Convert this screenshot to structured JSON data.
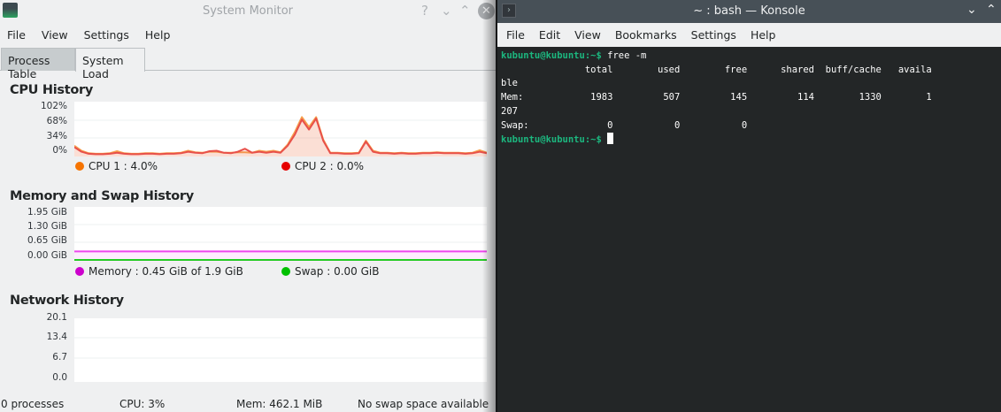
{
  "sysmon": {
    "title": "System Monitor",
    "menu": [
      "File",
      "View",
      "Settings",
      "Help"
    ],
    "tabs": [
      "Process Table",
      "System Load"
    ],
    "cpu": {
      "title": "CPU History",
      "yticks": [
        "102%",
        "68%",
        "34%",
        "0%"
      ],
      "legend": [
        {
          "label": "CPU 1 : 4.0%",
          "color": "#f67400"
        },
        {
          "label": "CPU 2 : 0.0%",
          "color": "#e60000"
        }
      ]
    },
    "memory": {
      "title": "Memory and Swap History",
      "yticks": [
        "1.95 GiB",
        "1.30 GiB",
        "0.65 GiB",
        "0.00 GiB"
      ],
      "legend": [
        {
          "label": "Memory : 0.45 GiB of 1.9 GiB",
          "color": "#cc00cc"
        },
        {
          "label": "Swap : 0.00 GiB",
          "color": "#00c000"
        }
      ]
    },
    "network": {
      "title": "Network History",
      "yticks": [
        "20.1",
        "13.4",
        "6.7",
        "0.0"
      ]
    },
    "status": {
      "processes": "0 processes",
      "cpu": "CPU: 3%",
      "mem": "Mem: 462.1 MiB",
      "swap": "No swap space available"
    }
  },
  "chart_data": [
    {
      "type": "area",
      "title": "CPU History",
      "ylim": [
        0,
        102
      ],
      "series": [
        {
          "name": "CPU 1",
          "color": "#f6a04d",
          "values": [
            18,
            8,
            3,
            2,
            2,
            3,
            7,
            3,
            2,
            2,
            3,
            3,
            2,
            3,
            3,
            4,
            8,
            5,
            4,
            6,
            6,
            4,
            4,
            5,
            5,
            4,
            8,
            6,
            8,
            5,
            20,
            45,
            75,
            55,
            75,
            30,
            4,
            4,
            3,
            3,
            4,
            28,
            8,
            4,
            4,
            3,
            4,
            3,
            3,
            4,
            4,
            5,
            4,
            4,
            4,
            3,
            4,
            9,
            4
          ]
        },
        {
          "name": "CPU 2",
          "color": "#e8504a",
          "values": [
            15,
            6,
            2,
            1,
            1,
            2,
            4,
            2,
            1,
            1,
            2,
            2,
            1,
            2,
            2,
            3,
            6,
            4,
            3,
            7,
            8,
            4,
            3,
            6,
            12,
            4,
            6,
            4,
            6,
            4,
            18,
            40,
            70,
            50,
            72,
            28,
            3,
            3,
            2,
            2,
            3,
            26,
            6,
            3,
            3,
            2,
            3,
            2,
            2,
            3,
            3,
            4,
            3,
            3,
            3,
            2,
            3,
            6,
            3
          ]
        }
      ]
    },
    {
      "type": "area",
      "title": "Memory and Swap History",
      "ylim": [
        0,
        1.95
      ],
      "series": [
        {
          "name": "Memory",
          "color": "#ee44ee",
          "values": [
            0.45
          ]
        },
        {
          "name": "Swap",
          "color": "#22cc22",
          "values": [
            0.0
          ]
        }
      ]
    },
    {
      "type": "line",
      "title": "Network History",
      "ylim": [
        0,
        20.1
      ],
      "series": []
    }
  ],
  "konsole": {
    "title": "~ : bash — Konsole",
    "menu": [
      "File",
      "Edit",
      "View",
      "Bookmarks",
      "Settings",
      "Help"
    ],
    "prompt": "kubuntu@kubuntu:~$",
    "command": " free -m",
    "output": [
      "               total        used        free      shared  buff/cache   availa",
      "ble",
      "Mem:            1983         507         145         114        1330        1",
      "207",
      "Swap:              0           0           0"
    ]
  }
}
